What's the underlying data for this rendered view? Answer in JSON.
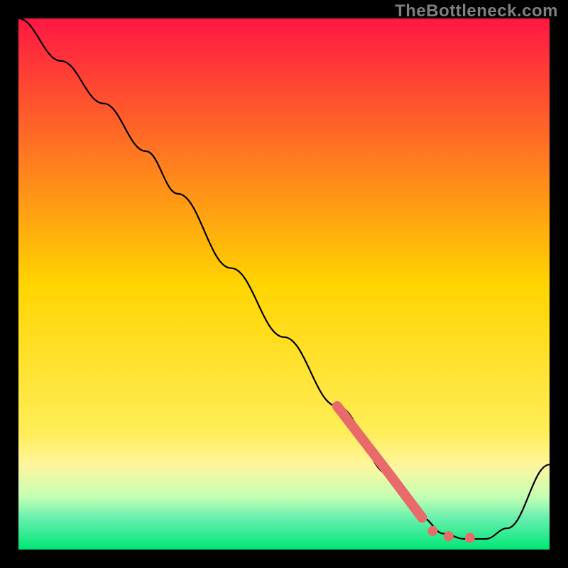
{
  "watermark": "TheBottleneck.com",
  "chart_data": {
    "type": "line",
    "title": "",
    "xlabel": "",
    "ylabel": "",
    "xlim": [
      0,
      100
    ],
    "ylim": [
      0,
      100
    ],
    "gradient_stops": [
      {
        "offset": 0.0,
        "color": "#ff1744"
      },
      {
        "offset": 0.5,
        "color": "#ffd400"
      },
      {
        "offset": 0.78,
        "color": "#ffee58"
      },
      {
        "offset": 0.84,
        "color": "#fff59d"
      },
      {
        "offset": 0.9,
        "color": "#c6ffb3"
      },
      {
        "offset": 0.94,
        "color": "#69f0ae"
      },
      {
        "offset": 1.0,
        "color": "#00e676"
      }
    ],
    "series": [
      {
        "name": "bottleneck-curve",
        "x": [
          0,
          8,
          16,
          24,
          30,
          40,
          50,
          60,
          70,
          76,
          80,
          84,
          88,
          92,
          100
        ],
        "y": [
          100,
          92,
          84,
          75,
          67,
          53,
          40,
          27,
          14,
          6,
          3,
          2,
          2,
          4,
          16
        ]
      }
    ],
    "highlight_segment": {
      "name": "steep-red-segment",
      "x": [
        60,
        70,
        76
      ],
      "y": [
        27,
        14,
        6
      ]
    },
    "highlight_dots": {
      "name": "optimum-dots",
      "points": [
        {
          "x": 78,
          "y": 3.5
        },
        {
          "x": 81,
          "y": 2.5
        },
        {
          "x": 85,
          "y": 2.2
        }
      ]
    },
    "colors": {
      "curve": "#000000",
      "highlight": "#e86a6a"
    }
  }
}
